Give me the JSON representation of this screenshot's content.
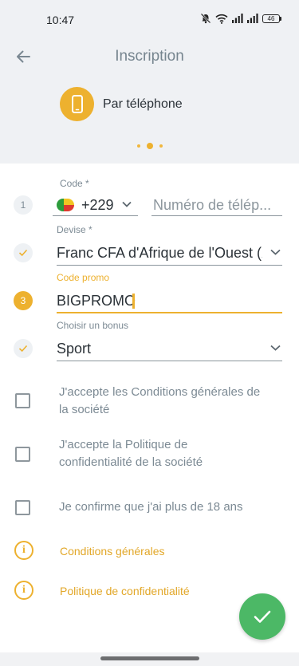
{
  "status_bar": {
    "time": "10:47",
    "battery": "46"
  },
  "header": {
    "title": "Inscription"
  },
  "method": {
    "label": "Par téléphone"
  },
  "form": {
    "step1": "1",
    "step3": "3",
    "code_label": "Code *",
    "code_value": "+229",
    "phone_placeholder": "Numéro de télép...",
    "currency_label": "Devise *",
    "currency_value": "Franc CFA d'Afrique de l'Ouest (X",
    "promo_label": "Code promo",
    "promo_value": "BIGPROMO",
    "bonus_label": "Choisir un bonus",
    "bonus_value": "Sport"
  },
  "agreements": [
    {
      "line1": "J'accepte les Conditions générales de",
      "line2": "la société"
    },
    {
      "line1": "J'accepte la Politique de",
      "line2": "confidentialité de la société"
    },
    {
      "line1": "Je confirme que j'ai plus de 18 ans"
    }
  ],
  "links": {
    "terms": "Conditions générales",
    "privacy": "Politique de confidentialité"
  },
  "colors": {
    "accent": "#edb12f",
    "confirm": "#4cb866",
    "header_bg": "#eff1f4"
  },
  "icons": [
    "back-arrow-icon",
    "phone-icon",
    "check-icon",
    "chevron-down-icon",
    "info-icon"
  ]
}
